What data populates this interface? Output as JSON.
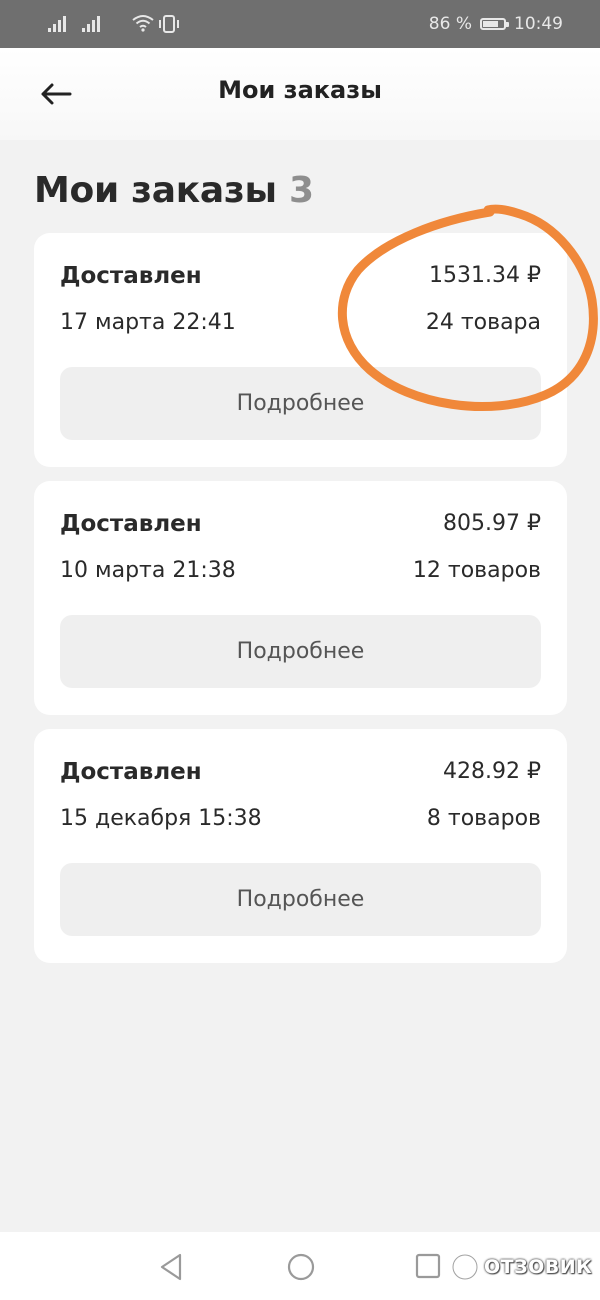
{
  "status_bar": {
    "battery_percent": "86 %",
    "battery_level": 0.86,
    "time": "10:49",
    "icons": [
      "signal-icon",
      "signal-icon",
      "wifi-icon",
      "vibrate-icon",
      "battery-icon"
    ]
  },
  "header": {
    "title": "Мои заказы",
    "back_icon": "arrow-left-icon"
  },
  "page": {
    "title": "Мои заказы",
    "count": "3"
  },
  "orders": [
    {
      "status": "Доставлен",
      "price": "1531.34 ₽",
      "date": "17 марта 22:41",
      "qty": "24 товара",
      "button_label": "Подробнее"
    },
    {
      "status": "Доставлен",
      "price": "805.97 ₽",
      "date": "10 марта 21:38",
      "qty": "12 товаров",
      "button_label": "Подробнее"
    },
    {
      "status": "Доставлен",
      "price": "428.92 ₽",
      "date": "15 декабря 15:38",
      "qty": "8 товаров",
      "button_label": "Подробнее"
    }
  ],
  "annotation": {
    "color": "#f0883a"
  },
  "nav_bar": {
    "icons": [
      "nav-back-icon",
      "nav-home-icon",
      "nav-recents-icon"
    ]
  },
  "watermark": {
    "text": "ОТЗОВИК"
  },
  "colors": {
    "background": "#f2f2f2",
    "card": "#ffffff",
    "button": "#efefef",
    "statusbar": "#6f6f6f"
  }
}
